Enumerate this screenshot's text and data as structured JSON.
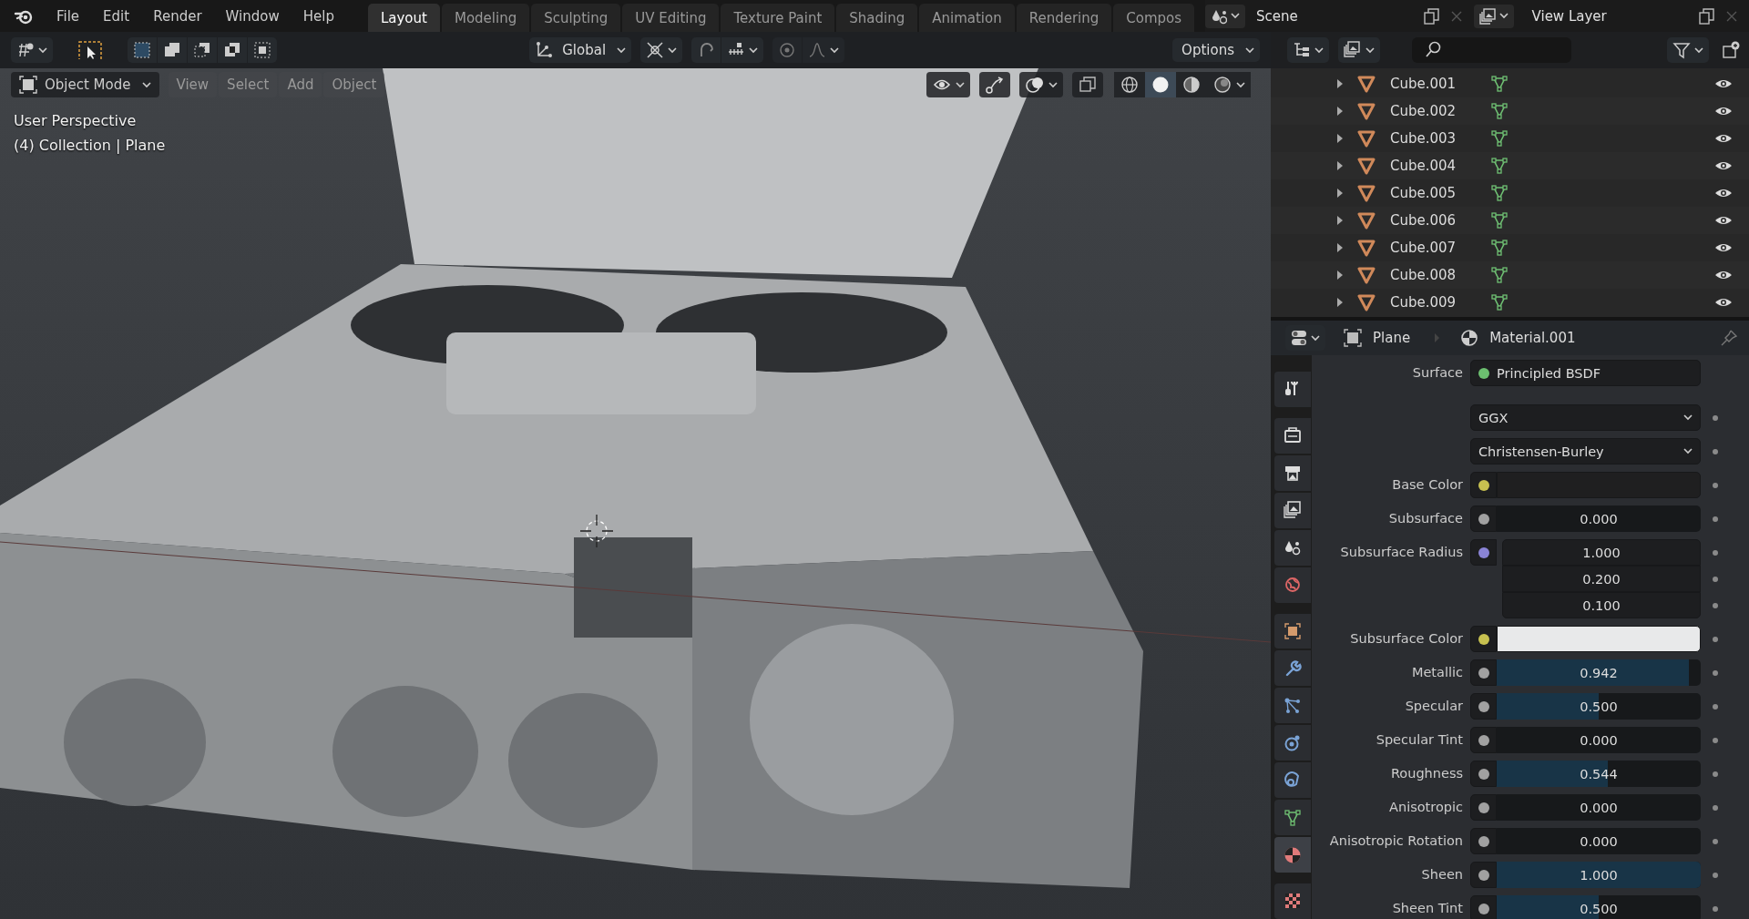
{
  "menu_bar": {
    "menus": [
      "File",
      "Edit",
      "Render",
      "Window",
      "Help"
    ]
  },
  "workspace_tabs": [
    {
      "label": "Layout",
      "selected": true
    },
    {
      "label": "Modeling",
      "selected": false
    },
    {
      "label": "Sculpting",
      "selected": false
    },
    {
      "label": "UV Editing",
      "selected": false
    },
    {
      "label": "Texture Paint",
      "selected": false
    },
    {
      "label": "Shading",
      "selected": false
    },
    {
      "label": "Animation",
      "selected": false
    },
    {
      "label": "Rendering",
      "selected": false
    },
    {
      "label": "Compos",
      "selected": false
    }
  ],
  "scene": {
    "name": "Scene"
  },
  "view_layer": {
    "name": "View Layer"
  },
  "tool_header": {
    "orientation": "Global",
    "options": "Options"
  },
  "viewport": {
    "mode": "Object Mode",
    "menus": [
      "View",
      "Select",
      "Add",
      "Object"
    ],
    "info": [
      "User Perspective",
      "(4) Collection | Plane"
    ]
  },
  "outliner": {
    "items": [
      {
        "name": "Cube.001",
        "expanded": false,
        "visible": true
      },
      {
        "name": "Cube.002",
        "expanded": false,
        "visible": true
      },
      {
        "name": "Cube.003",
        "expanded": false,
        "visible": true
      },
      {
        "name": "Cube.004",
        "expanded": false,
        "visible": true
      },
      {
        "name": "Cube.005",
        "expanded": false,
        "visible": true
      },
      {
        "name": "Cube.006",
        "expanded": false,
        "visible": true
      },
      {
        "name": "Cube.007",
        "expanded": false,
        "visible": true
      },
      {
        "name": "Cube.008",
        "expanded": false,
        "visible": true
      },
      {
        "name": "Cube.009",
        "expanded": false,
        "visible": true
      }
    ]
  },
  "properties": {
    "breadcrumb": [
      "Plane",
      "Material.001"
    ],
    "tabs": [
      {
        "kind": "tool",
        "selected": false
      },
      {
        "kind": "render",
        "selected": false
      },
      {
        "kind": "output",
        "selected": false
      },
      {
        "kind": "view_layer",
        "selected": false
      },
      {
        "kind": "scene",
        "selected": false
      },
      {
        "kind": "world",
        "selected": false
      },
      {
        "kind": "object",
        "selected": false
      },
      {
        "kind": "modifier",
        "selected": false
      },
      {
        "kind": "particles",
        "selected": false
      },
      {
        "kind": "physics",
        "selected": false
      },
      {
        "kind": "constraints",
        "selected": false
      },
      {
        "kind": "data",
        "selected": false
      },
      {
        "kind": "material",
        "selected": true
      },
      {
        "kind": "texture",
        "selected": false
      }
    ],
    "fields": [
      {
        "kind": "shader",
        "label": "Surface",
        "value": "Principled BSDF",
        "color": "#6cc070"
      },
      {
        "kind": "dropdown",
        "value": "GGX"
      },
      {
        "kind": "dropdown",
        "value": "Christensen-Burley"
      },
      {
        "kind": "color",
        "label": "Base Color",
        "color": "#c7c150",
        "swatch": {
          "color": "#1f1f20"
        }
      },
      {
        "kind": "slider",
        "label": "Subsurface",
        "color": "#a1a1a1",
        "value": "0.000",
        "level": 0
      },
      {
        "kind": "vector",
        "label": "Subsurface Radius",
        "color": "#8a84d6",
        "values": [
          "1.000",
          "0.200",
          "0.100"
        ]
      },
      {
        "kind": "color",
        "label": "Subsurface Color",
        "color": "#c7c150",
        "swatch": {
          "color": "#e8e9ea"
        }
      },
      {
        "kind": "slider",
        "label": "Metallic",
        "color": "#a1a1a1",
        "value": "0.942",
        "level": 0.942
      },
      {
        "kind": "slider",
        "label": "Specular",
        "color": "#a1a1a1",
        "value": "0.500",
        "level": 0.5
      },
      {
        "kind": "slider",
        "label": "Specular Tint",
        "color": "#a1a1a1",
        "value": "0.000",
        "level": 0
      },
      {
        "kind": "slider",
        "label": "Roughness",
        "color": "#a1a1a1",
        "value": "0.544",
        "level": 0.544
      },
      {
        "kind": "slider",
        "label": "Anisotropic",
        "color": "#a1a1a1",
        "value": "0.000",
        "level": 0
      },
      {
        "kind": "slider",
        "label": "Anisotropic Rotation",
        "color": "#a1a1a1",
        "value": "0.000",
        "level": 0
      },
      {
        "kind": "slider",
        "label": "Sheen",
        "color": "#a1a1a1",
        "value": "1.000",
        "level": 1
      },
      {
        "kind": "slider",
        "label": "Sheen Tint",
        "color": "#a1a1a1",
        "value": "0.500",
        "level": 0.5
      }
    ]
  }
}
